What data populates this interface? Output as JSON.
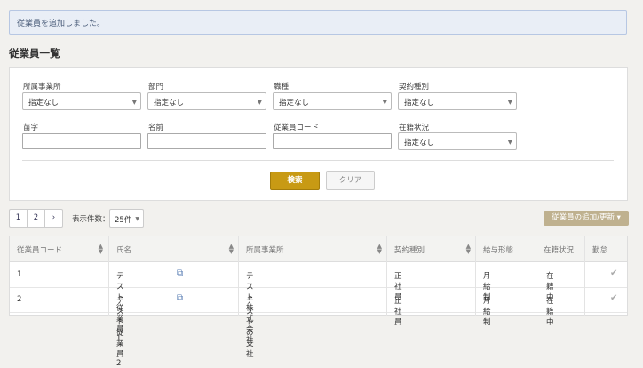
{
  "alert": {
    "message": "従業員を追加しました。"
  },
  "page_title": "従業員一覧",
  "filters": {
    "office": {
      "label": "所属事業所",
      "value": "指定なし"
    },
    "department": {
      "label": "部門",
      "value": "指定なし"
    },
    "job_type": {
      "label": "職種",
      "value": "指定なし"
    },
    "contract_type": {
      "label": "契約種別",
      "value": "指定なし"
    },
    "last_name": {
      "label": "苗字",
      "value": ""
    },
    "first_name": {
      "label": "名前",
      "value": ""
    },
    "employee_code": {
      "label": "従業員コード",
      "value": ""
    },
    "status": {
      "label": "在籍状況",
      "value": "指定なし"
    }
  },
  "buttons": {
    "search": "検索",
    "clear": "クリア",
    "add_update": "従業員の追加/更新 ▾"
  },
  "pagination": {
    "page1": "1",
    "page2": "2",
    "next": "›"
  },
  "page_size": {
    "label": "表示件数：",
    "value": "25件"
  },
  "table": {
    "headers": {
      "code": "従業員コード",
      "name": "氏名",
      "office": "所属事業所",
      "contract": "契約種別",
      "pay": "給与形態",
      "status": "在籍状況",
      "attendance": "勤怠"
    },
    "rows": [
      {
        "code": "1",
        "name": "テスト従業員1",
        "office": "テスト株式会社",
        "contract": "正社員",
        "pay": "月給制",
        "status": "在籍中"
      },
      {
        "code": "2",
        "name": "テスト従業員2",
        "office": "テストの支社",
        "contract": "正社員",
        "pay": "月給制",
        "status": "在籍中"
      }
    ]
  }
}
